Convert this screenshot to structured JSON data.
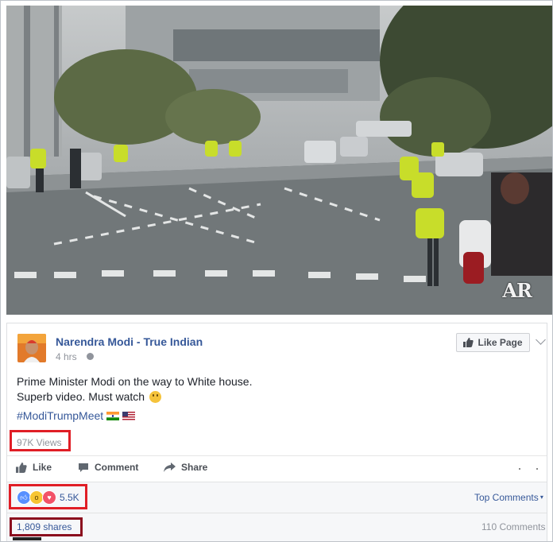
{
  "video": {
    "watermark": "AR"
  },
  "post": {
    "page_name": "Narendra Modi - True Indian",
    "time": "4 hrs",
    "like_page_label": "Like Page",
    "message_line1": "Prime Minister Modi on the way to White house.",
    "message_line2": "Superb video. Must watch",
    "hashtag": "#ModiTrumpMeet",
    "views": "97K Views"
  },
  "actions": {
    "like": "Like",
    "comment": "Comment",
    "share": "Share"
  },
  "footer": {
    "reaction_count": "5.5K",
    "top_comments": "Top Comments",
    "shares": "1,809 shares",
    "comments_count": "110 Comments"
  },
  "colors": {
    "link": "#365899",
    "highlight_red": "#e01e26",
    "highlight_dark_red": "#8b0e1e"
  },
  "icons": [
    "globe-icon",
    "thumbs-up-icon",
    "comment-icon",
    "share-arrow-icon",
    "like-reaction-icon",
    "wow-reaction-icon",
    "love-reaction-icon",
    "chevron-down-icon"
  ]
}
